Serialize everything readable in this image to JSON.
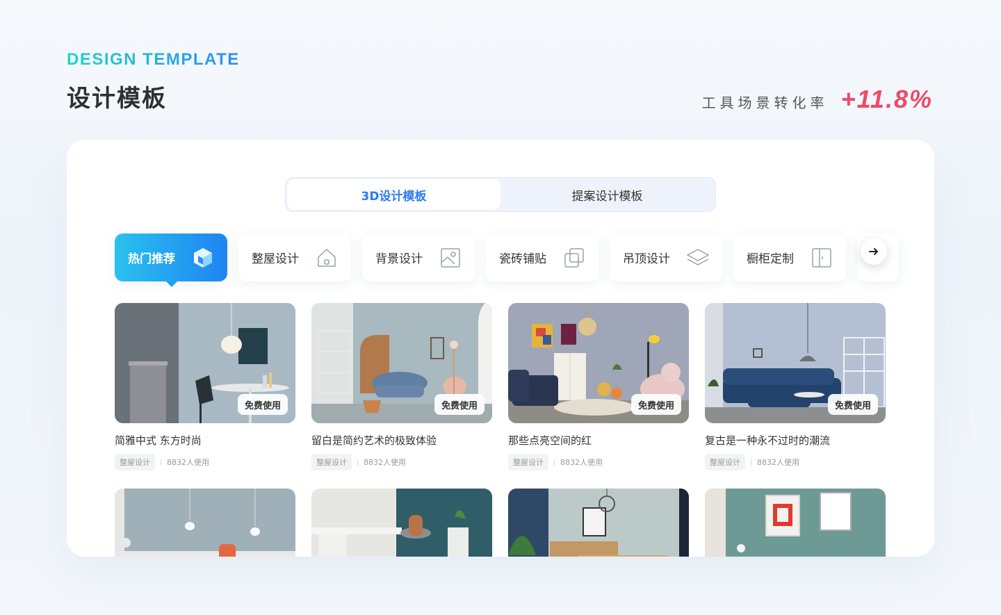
{
  "header": {
    "eyebrow": "DESIGN TEMPLATE",
    "title": "设计模板",
    "metric_label": "工具场景转化率",
    "metric_value": "+11.8%"
  },
  "tabs": [
    {
      "label": "3D设计模板",
      "active": true
    },
    {
      "label": "提案设计模板",
      "active": false
    }
  ],
  "categories": [
    {
      "label": "热门推荐",
      "icon": "cube-icon",
      "active": true
    },
    {
      "label": "整屋设计",
      "icon": "house-icon"
    },
    {
      "label": "背景设计",
      "icon": "image-icon"
    },
    {
      "label": "瓷砖铺贴",
      "icon": "tiles-icon"
    },
    {
      "label": "吊顶设计",
      "icon": "layers-icon"
    },
    {
      "label": "橱柜定制",
      "icon": "cabinet-icon"
    }
  ],
  "cards": [
    {
      "title": "简雅中式 东方时尚",
      "tag": "整屋设计",
      "uses": "8832人使用",
      "button": "免费使用"
    },
    {
      "title": "留白是简约艺术的极致体验",
      "tag": "整屋设计",
      "uses": "8832人使用",
      "button": "免费使用"
    },
    {
      "title": "那些点亮空间的红",
      "tag": "整屋设计",
      "uses": "8832人使用",
      "button": "免费使用"
    },
    {
      "title": "复古是一种永不过时的潮流",
      "tag": "整屋设计",
      "uses": "8832人使用",
      "button": "免费使用"
    }
  ],
  "colors": {
    "accent_blue": "#2d7bf0",
    "metric_red": "#ef4a6a",
    "gradient_start": "#2ac1ee",
    "gradient_end": "#1e84f2"
  }
}
